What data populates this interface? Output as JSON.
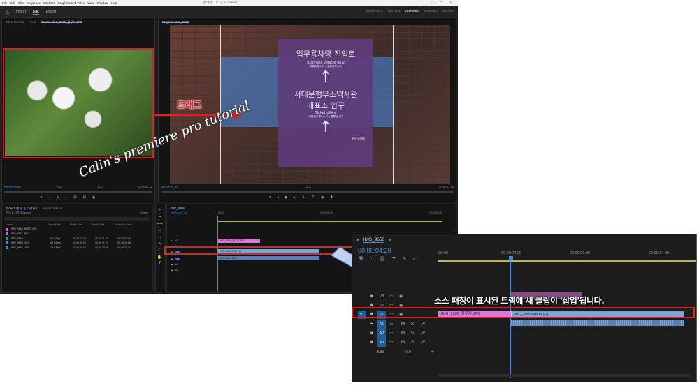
{
  "menubar": {
    "items": [
      "File",
      "Edit",
      "Clip",
      "Sequence",
      "Markers",
      "Graphics and Titles",
      "View",
      "Window",
      "Help"
    ],
    "window_title": "빈 테 튜 그리기 1 - Edited",
    "window_buttons": "- □ ×"
  },
  "header": {
    "tabs": [
      "Import",
      "Edit",
      "Export"
    ],
    "active_tab": "Edit",
    "workspaces": [
      "ESSENTIALS",
      "VERTICAL",
      "LEARNING",
      "ASSEMBLY",
      "EDITING"
    ],
    "active_workspace": "LEARNING"
  },
  "source": {
    "tabs": [
      "Effect Controls",
      "Text",
      "Source: IMG_9586_물무지.JPG"
    ],
    "timecode": "00;00;00;00",
    "zoom": "37%",
    "quality": "Full",
    "duration": "00;00;04;29"
  },
  "program": {
    "tab": "Program: IMG_9658",
    "timecode": "00;00;04;29",
    "quality": "Full",
    "duration": "00;00;11;28",
    "sign": {
      "line1": "업무용차량 진입로",
      "line2": "Business vehicle only",
      "line3": "業務用車入口 | 业务用车入口",
      "line4": "서대문형무소역사관",
      "line5": "매표소 입구",
      "line6": "Ticket office",
      "line7": "切符売り場の入口 | 售票处入口",
      "phone": "360-8590"
    }
  },
  "annotations": {
    "drag": "드래그",
    "watermark": "Calin's premiere pro tutorial",
    "callout_caption": "소스 패칭이 표시된 트랙에 새 클립이 '삽입'됩니다."
  },
  "project": {
    "tabs": [
      "Project: 빈 테 튜 그리기 1",
      "Media Browser"
    ],
    "file": "빈 테 튜 그리기 1.prproj",
    "count": "5 items",
    "columns": [
      "Name",
      "Frame Rate",
      "Media Start",
      "Media End",
      "Media Duration"
    ],
    "items": [
      {
        "name": "IMG_9586_물무지.JPG",
        "rate": "",
        "start": "",
        "end": "",
        "dur": "",
        "color": "#cd6fd6"
      },
      {
        "name": "IMG_9591.JPG",
        "rate": "",
        "start": "",
        "end": "",
        "dur": "",
        "color": "#cd6fd6"
      },
      {
        "name": "IMG_9658",
        "rate": "59.94 fps",
        "start": "00;00;00;00",
        "end": "00;00;11;27",
        "dur": "00;00;11;28",
        "color": "#2f9a74"
      },
      {
        "name": "IMG_9658.MOV",
        "rate": "59.94 fps",
        "start": "00;00;00;00",
        "end": "00;00;11;27",
        "dur": "00;00;11;28",
        "color": "#5b7fbf"
      },
      {
        "name": "IMG_9662.MOV",
        "rate": "29.97 fps",
        "start": "00;00;00;00",
        "end": "00;00;10;26",
        "dur": "00;00;10;27",
        "color": "#5b7fbf"
      }
    ]
  },
  "timeline_small": {
    "tab": "IMG_9658",
    "timecode": "00;00;04;29",
    "ruler": [
      "00;00",
      "00;00;04;29",
      "00;00;09;29"
    ],
    "tracks": [
      "V3",
      "V2",
      "V1",
      "A1",
      "A2",
      "A3"
    ],
    "clips": [
      "IMG_9586_물무지.JPG",
      "IMG_9658.MOV [V]",
      "IMG_9658.MOV"
    ]
  },
  "callout": {
    "tab": "IMG_9658",
    "timecode": "00:00:04:29",
    "ruler": [
      "00:00",
      "00:00:04:29",
      "00:00:09:29",
      "00:00:14:29"
    ],
    "tracks": [
      {
        "src": "",
        "id": "V3"
      },
      {
        "src": "",
        "id": "V2"
      },
      {
        "src": "V1",
        "id": "V1"
      },
      {
        "src": "",
        "id": "A1"
      },
      {
        "src": "",
        "id": "A2"
      },
      {
        "src": "",
        "id": "A3"
      }
    ],
    "mix_label": "Mix",
    "mix_value": "0.0",
    "m_label": "M",
    "s_label": "S",
    "clip_photo": "IMG_9586_물무지.JPG",
    "clip_video": "IMG_9658.MOV [V]"
  },
  "colors": {
    "accent": "#3f8fe8",
    "highlight": "#e02020",
    "clip_photo": "#d57ad8",
    "clip_video": "#7fa5d4",
    "clip_audio": "#5a7fb2"
  }
}
